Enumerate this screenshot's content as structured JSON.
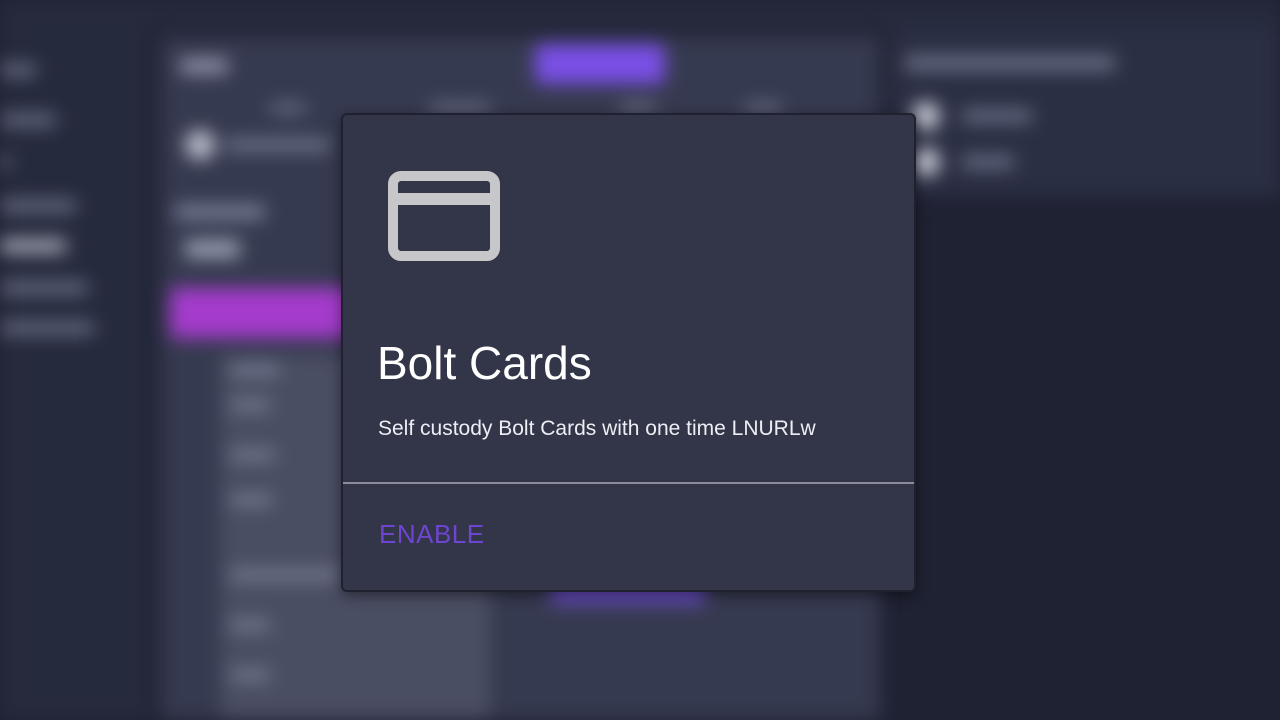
{
  "card": {
    "icon": "credit-card-icon",
    "title": "Bolt Cards",
    "description": "Self custody Bolt Cards with one time LNURLw",
    "enable_label": "ENABLE"
  },
  "colors": {
    "card_background": "#333548",
    "accent": "#6e45d0",
    "page_background": "#1f2233",
    "icon": "#c7c7c9"
  }
}
